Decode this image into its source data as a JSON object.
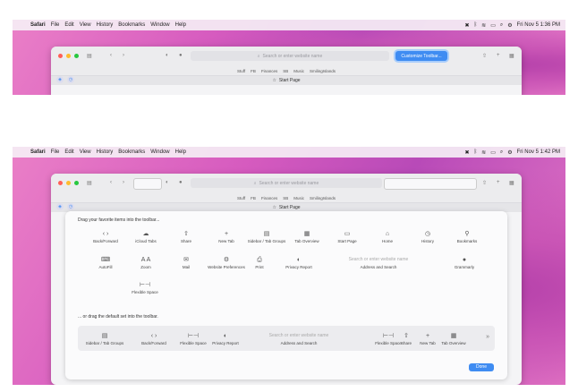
{
  "menu": {
    "app": "Safari",
    "items": [
      "File",
      "Edit",
      "View",
      "History",
      "Bookmarks",
      "Window",
      "Help"
    ],
    "datetime_top": "Fri Nov 5  1:36 PM",
    "datetime_bottom": "Fri Nov 5  1:42 PM"
  },
  "toolbar": {
    "search_placeholder": "Search or enter website name",
    "customize_button": "Customize Toolbar..."
  },
  "favorites": [
    "Stuff",
    "FB",
    "Finances",
    "SB",
    "Music",
    "SmilingIslands"
  ],
  "tab": {
    "label": "Start Page"
  },
  "sheet": {
    "heading": "Drag your favorite items into the toolbar...",
    "row1": [
      {
        "label": "Back/Forward",
        "icon": "chevrons-icon"
      },
      {
        "label": "iCloud Tabs",
        "icon": "cloud-icon"
      },
      {
        "label": "Share",
        "icon": "share-icon"
      },
      {
        "label": "New Tab",
        "icon": "plus-icon"
      },
      {
        "label": "Sidebar / Tab Groups",
        "icon": "sidebar-icon"
      },
      {
        "label": "Tab Overview",
        "icon": "grid-icon"
      },
      {
        "label": "Start Page",
        "icon": "browser-icon"
      },
      {
        "label": "Home",
        "icon": "home-icon"
      },
      {
        "label": "History",
        "icon": "clock-icon"
      },
      {
        "label": "Bookmarks",
        "icon": "bookmark-icon"
      }
    ],
    "row2": [
      {
        "label": "AutoFill",
        "icon": "autofill-icon"
      },
      {
        "label": "Zoom",
        "icon": "zoom-icon"
      },
      {
        "label": "Mail",
        "icon": "mail-icon"
      },
      {
        "label": "Website Preferences",
        "icon": "gear-icon"
      },
      {
        "label": "Print",
        "icon": "print-icon"
      },
      {
        "label": "Privacy Report",
        "icon": "shield-icon"
      }
    ],
    "address_search": {
      "placeholder": "Search or enter website name",
      "label": "Address and Search"
    },
    "grammarly": {
      "label": "Grammarly",
      "icon": "grammarly-icon"
    },
    "flexible_space": {
      "label": "Flexible Space"
    },
    "default_heading": "... or drag the default set into the toolbar.",
    "default_set": [
      {
        "label": "Sidebar / Tab Groups"
      },
      {
        "label": "Back/Forward"
      },
      {
        "label": "Flexible Space"
      },
      {
        "label": "Privacy Report"
      },
      {
        "label": "Address and Search"
      },
      {
        "label": "Flexible Space"
      },
      {
        "label": "Share"
      },
      {
        "label": "New Tab"
      },
      {
        "label": "Tab Overview"
      }
    ],
    "done_button": "Done"
  }
}
